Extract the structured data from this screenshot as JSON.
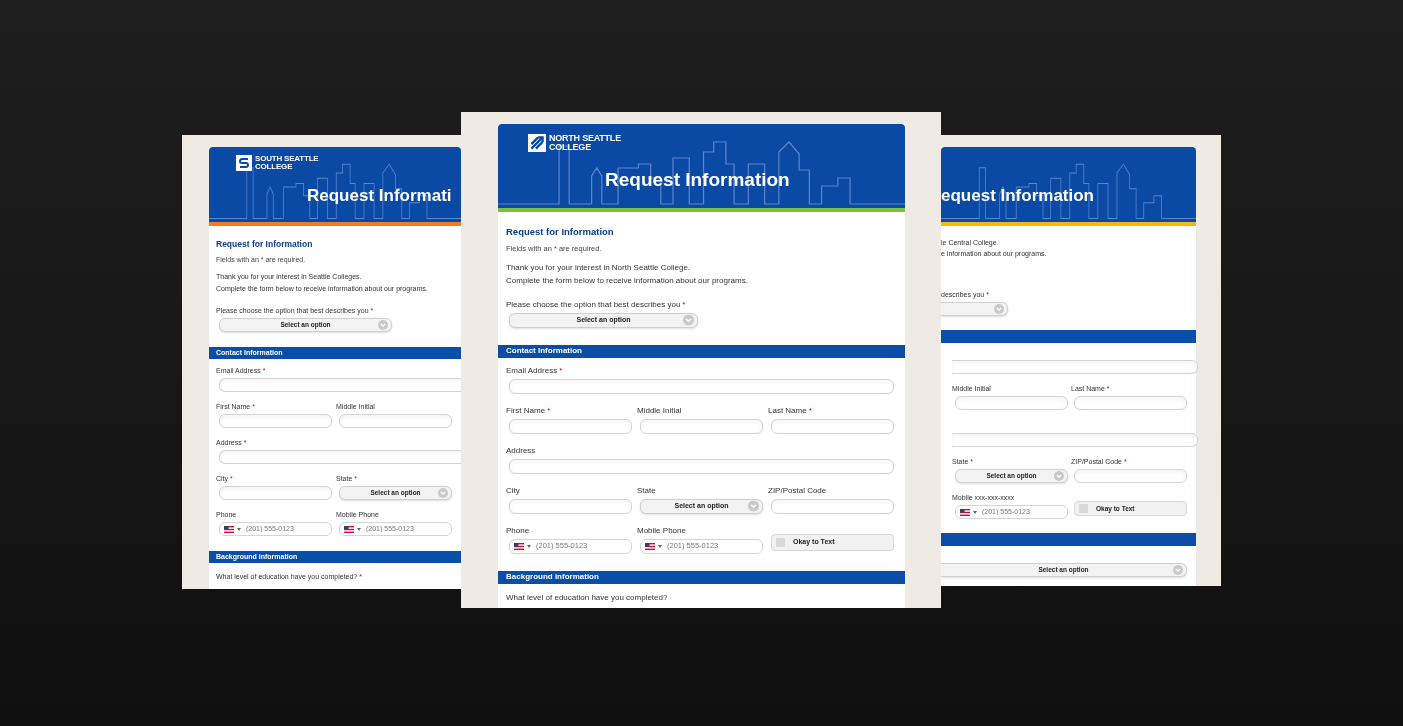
{
  "pages": [
    {
      "logo": {
        "lines": [
          "SOUTH SEATTLE",
          "COLLEGE"
        ]
      },
      "title": "Request Informati",
      "color": "#f47b20",
      "blocks": [
        {
          "kind": "heading",
          "text": "Request for Information"
        },
        {
          "kind": "note",
          "parts": [
            "Fields with an ",
            "*",
            " are required."
          ]
        },
        {
          "kind": "intro",
          "lines": [
            "Thank you for your interest in Seattle Colleges.",
            "Complete the form below to receive information about our programs."
          ]
        },
        {
          "kind": "question",
          "label": "Please choose the option that best describes you",
          "required_mark": "*"
        },
        {
          "kind": "select",
          "value": "Select an option"
        },
        {
          "kind": "section",
          "text": "Contact Information"
        },
        {
          "kind": "row",
          "fields": [
            {
              "kind": "text",
              "label": "Email Address",
              "required_mark": "*"
            }
          ]
        },
        {
          "kind": "row",
          "fields": [
            {
              "kind": "text",
              "label": "First Name",
              "required_mark": "*"
            },
            {
              "kind": "text",
              "label": "Middle Initial"
            }
          ]
        },
        {
          "kind": "row",
          "fields": [
            {
              "kind": "text",
              "label": "Address",
              "required_mark": "*"
            }
          ]
        },
        {
          "kind": "row",
          "fields": [
            {
              "kind": "text",
              "label": "City",
              "required_mark": "*"
            },
            {
              "kind": "select",
              "label": "State",
              "required_mark": "*",
              "value": "Select an option"
            }
          ]
        },
        {
          "kind": "row",
          "fields": [
            {
              "kind": "phone",
              "label": "Phone",
              "placeholder": "(201) 555-0123"
            },
            {
              "kind": "phone",
              "label": "Mobile Phone",
              "placeholder": "(201) 555-0123"
            }
          ]
        },
        {
          "kind": "section",
          "text": "Background information"
        },
        {
          "kind": "question",
          "label": "What level of education have you completed?",
          "required_mark": "*"
        }
      ]
    },
    {
      "logo": {
        "lines": [
          "NORTH SEATTLE",
          "COLLEGE"
        ]
      },
      "title": "Request Information",
      "color": "#7cc242",
      "blocks": [
        {
          "kind": "heading",
          "text": "Request for Information"
        },
        {
          "kind": "note",
          "parts": [
            "Fields with an ",
            "*",
            " are required."
          ]
        },
        {
          "kind": "intro",
          "lines": [
            "Thank you for your interest in North Seattle College.",
            "Complete the form below to receive information about our programs."
          ]
        },
        {
          "kind": "question",
          "label": "Please choose the option that best describes you",
          "required_mark": "*"
        },
        {
          "kind": "select",
          "value": "Select an option"
        },
        {
          "kind": "section",
          "text": "Contact Information"
        },
        {
          "kind": "row",
          "fields": [
            {
              "kind": "text",
              "label": "Email Address",
              "required_mark": "*"
            }
          ]
        },
        {
          "kind": "row",
          "fields": [
            {
              "kind": "text",
              "label": "First Name",
              "required_mark": "*"
            },
            {
              "kind": "text",
              "label": "Middle Initial"
            },
            {
              "kind": "text",
              "label": "Last Name",
              "required_mark": "*"
            }
          ]
        },
        {
          "kind": "row",
          "fields": [
            {
              "kind": "text",
              "label": "Address"
            }
          ]
        },
        {
          "kind": "row",
          "fields": [
            {
              "kind": "text",
              "label": "City"
            },
            {
              "kind": "select",
              "label": "State",
              "value": "Select an option"
            },
            {
              "kind": "text",
              "label": "ZIP/Postal Code"
            }
          ]
        },
        {
          "kind": "row",
          "fields": [
            {
              "kind": "phone",
              "label": "Phone",
              "placeholder": "(201) 555-0123"
            },
            {
              "kind": "phone",
              "label": "Mobile Phone",
              "placeholder": "(201) 555-0123"
            },
            {
              "kind": "checkbox",
              "label": "Okay to Text",
              "checked": false
            }
          ]
        },
        {
          "kind": "section",
          "text": "Background information"
        },
        {
          "kind": "question",
          "label": "What level of education have you completed?"
        }
      ]
    },
    {
      "title": "equest Information",
      "color": "#f5b80f",
      "blocks": [
        {
          "kind": "intro",
          "lines": [
            "le Central College.",
            "e information about our programs."
          ]
        },
        {
          "kind": "question",
          "label": "describes you",
          "required_mark": "*"
        },
        {
          "kind": "select"
        },
        {
          "kind": "section"
        },
        {
          "kind": "row",
          "fields": [
            {
              "kind": "text"
            }
          ]
        },
        {
          "kind": "row",
          "fields": [
            {
              "kind": "text",
              "label": "Middle Initial"
            },
            {
              "kind": "text",
              "label": "Last Name",
              "required_mark": "*"
            }
          ]
        },
        {
          "kind": "row",
          "fields": [
            {
              "kind": "text"
            }
          ]
        },
        {
          "kind": "row",
          "fields": [
            {
              "kind": "select",
              "label": "State",
              "required_mark": "*",
              "value": "Select an option"
            },
            {
              "kind": "text",
              "label": "ZIP/Postal Code",
              "required_mark": "*"
            }
          ]
        },
        {
          "kind": "row",
          "fields": [
            {
              "kind": "phone",
              "label": "Mobile xxx-xxx-xxxx",
              "placeholder": "(201) 555-0123"
            },
            {
              "kind": "checkbox",
              "label": "Okay to Text",
              "checked": false
            }
          ]
        },
        {
          "kind": "section"
        },
        {
          "kind": "select",
          "value": "Select an option"
        }
      ]
    }
  ]
}
